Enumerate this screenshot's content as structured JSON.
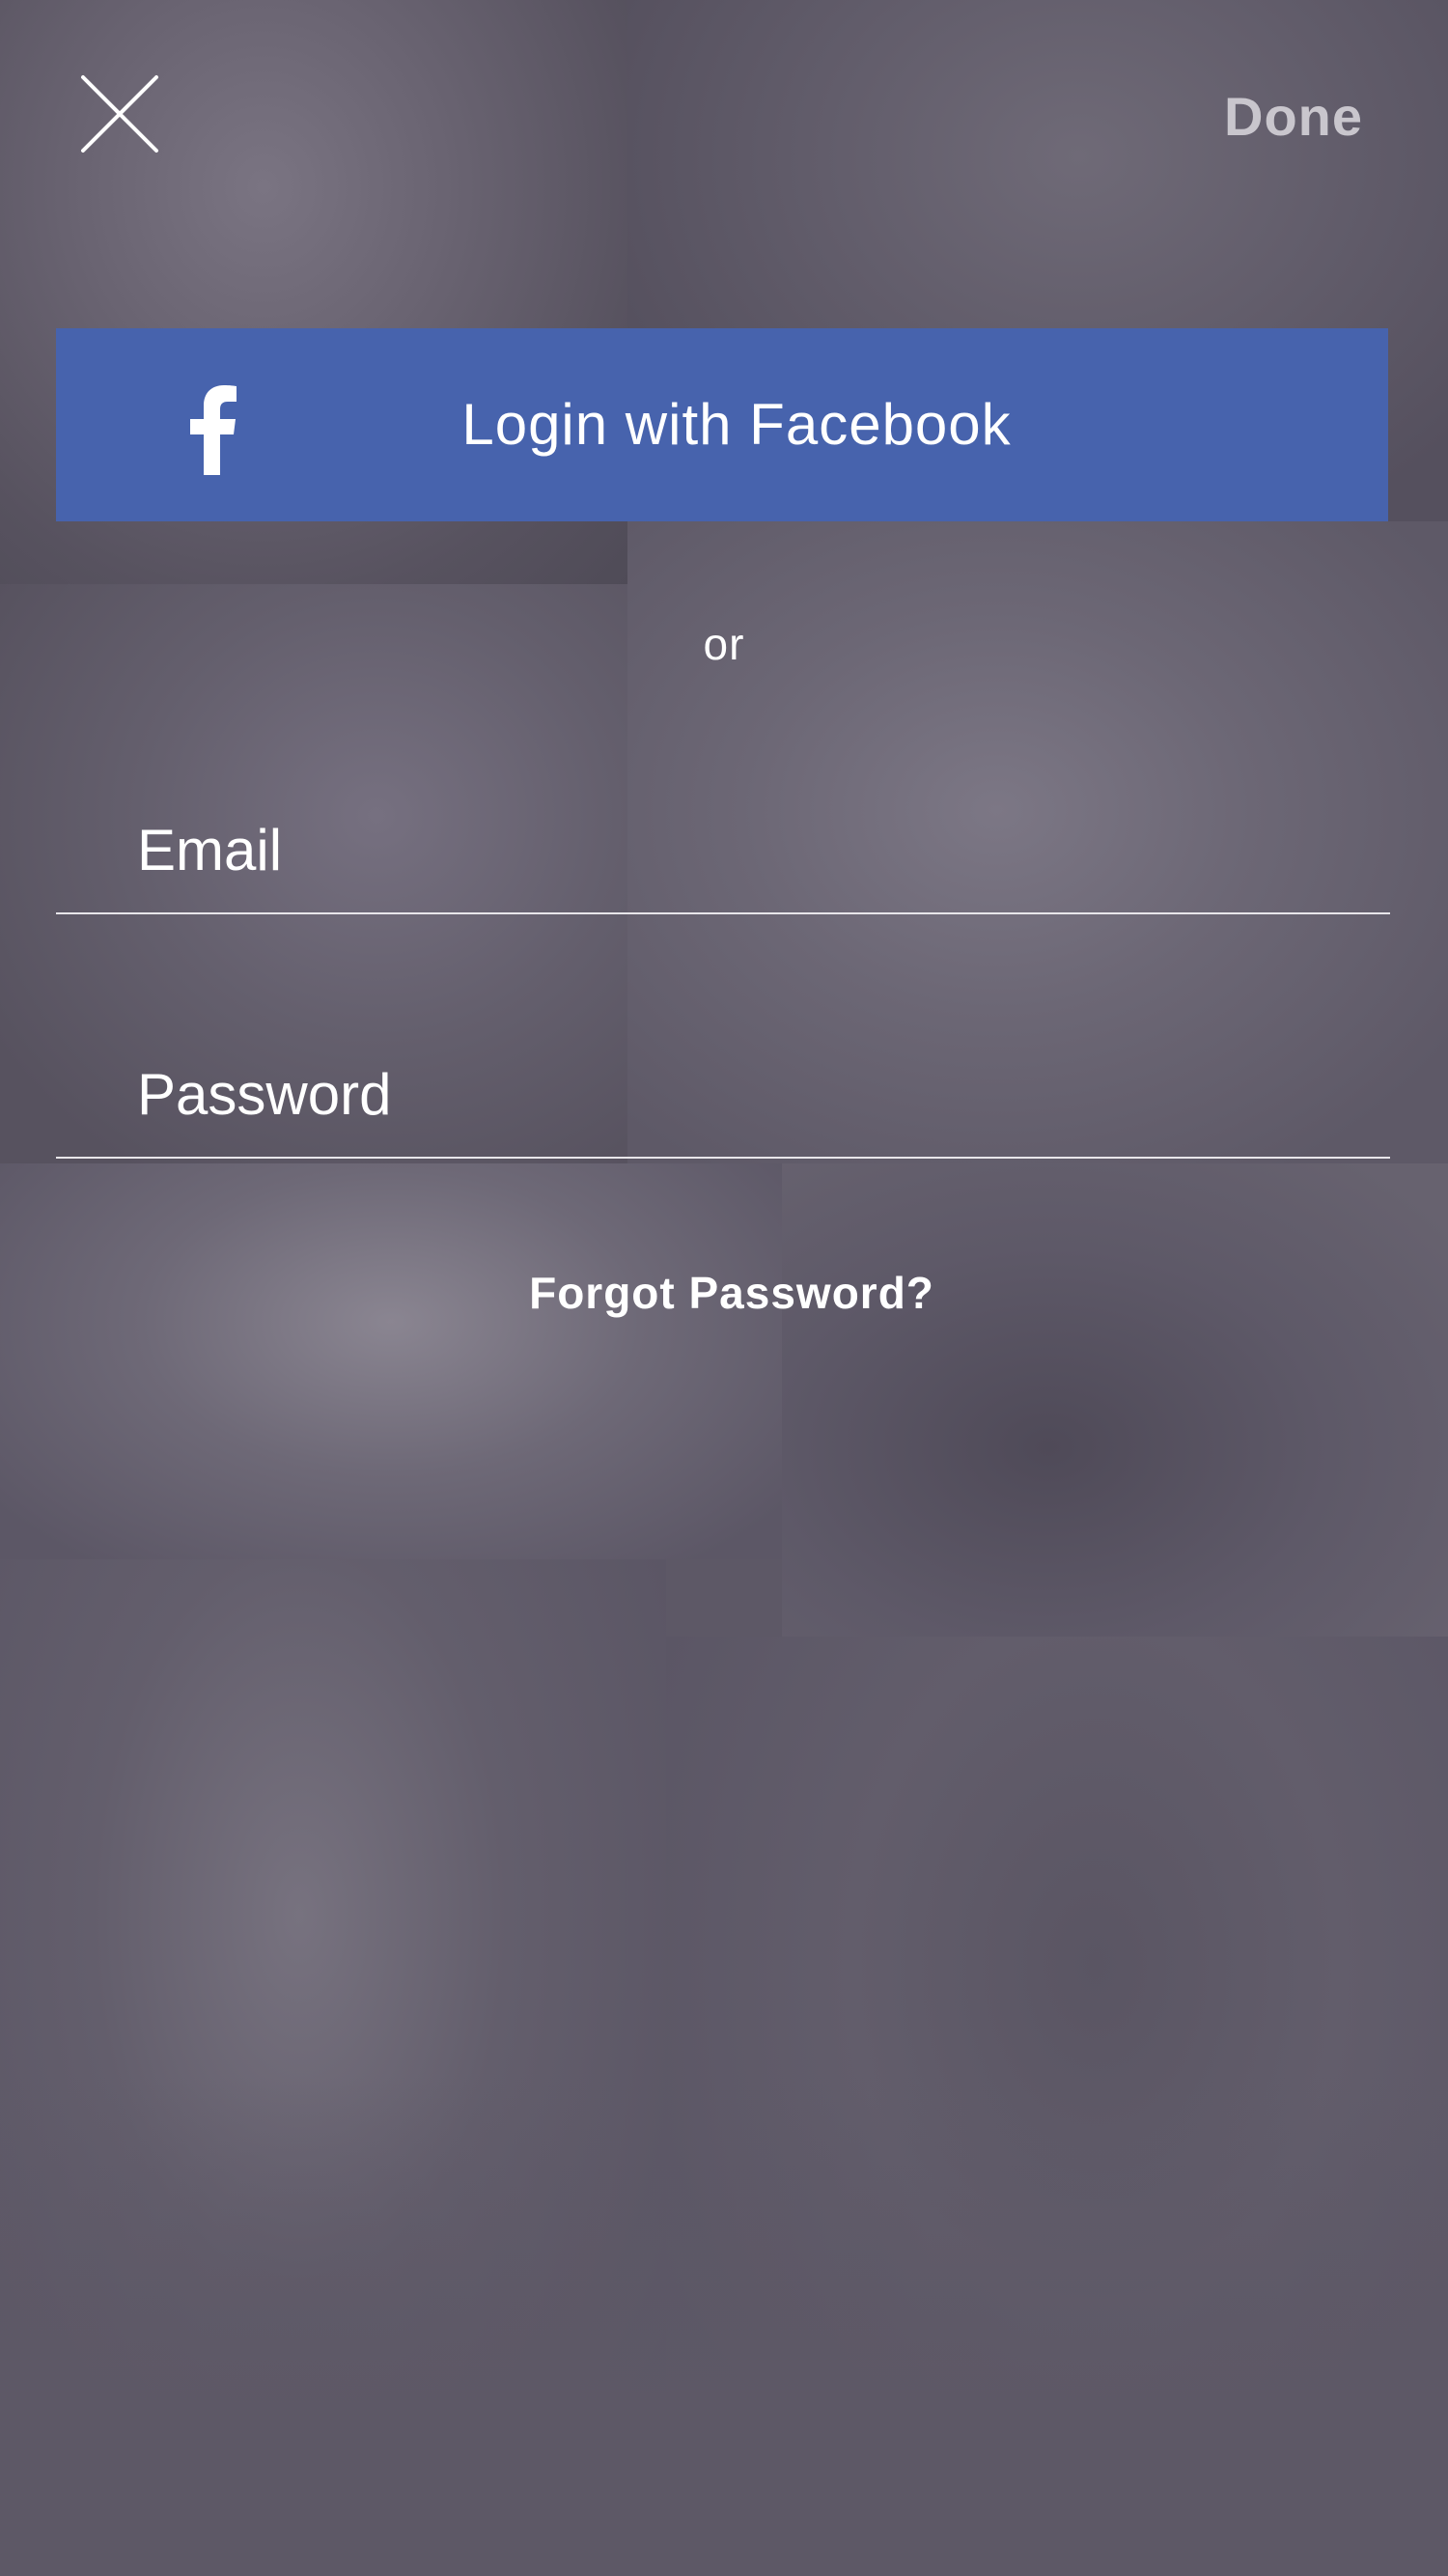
{
  "header": {
    "close_icon": "close-icon",
    "done_label": "Done"
  },
  "facebook": {
    "icon": "facebook-f-icon",
    "label": "Login with Facebook",
    "color": "#4763ad"
  },
  "divider_text": "or",
  "form": {
    "email_placeholder": "Email",
    "email_value": "",
    "password_placeholder": "Password",
    "password_value": ""
  },
  "forgot_password_label": "Forgot Password?"
}
